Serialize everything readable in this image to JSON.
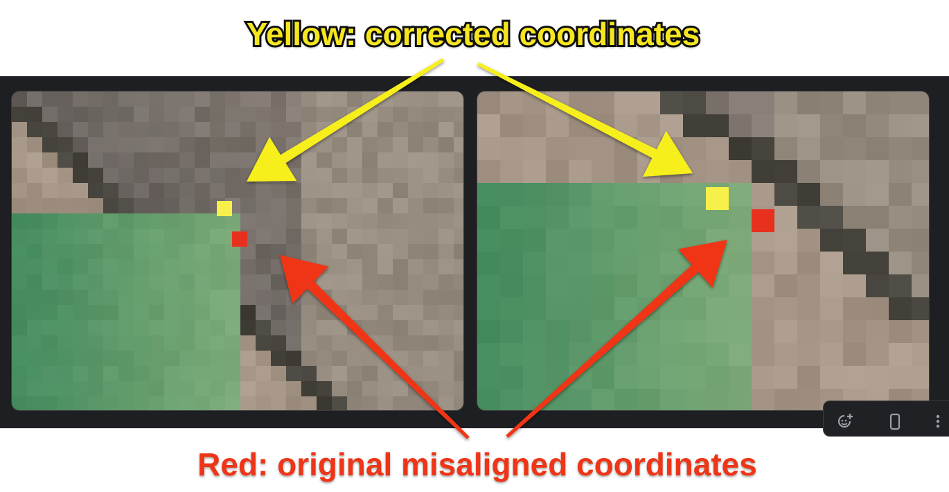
{
  "captions": {
    "top": "Yellow: corrected coordinates",
    "bottom": "Red: original misaligned coordinates"
  },
  "colors": {
    "yellow_marker": "#f7ef4a",
    "red_marker": "#e8301f",
    "yellow_arrow": "#f7ef1e",
    "red_arrow": "#f03512",
    "strip_bg": "#1e1f22"
  },
  "toolbar": {
    "icons": [
      "add-sticker-icon",
      "phone-icon",
      "more-vertical-icon"
    ]
  }
}
